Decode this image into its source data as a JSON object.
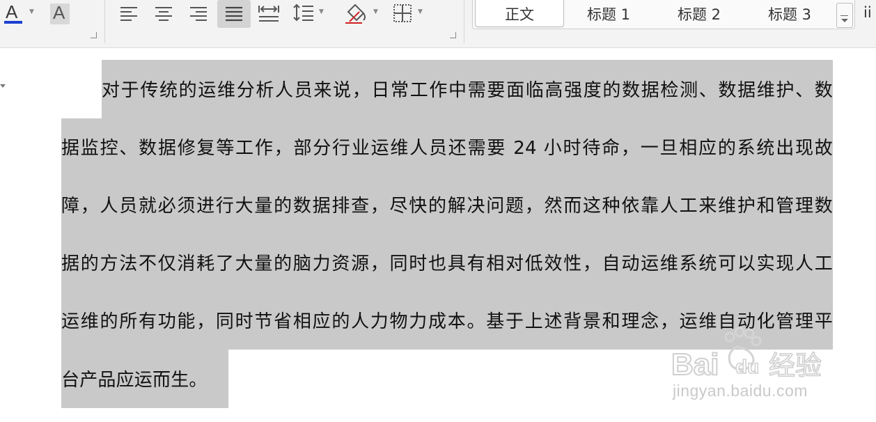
{
  "ribbon": {
    "font_color_letter": "A",
    "char_shading_letter": "A",
    "font_color_underline": "#1a3fd0",
    "groups": {
      "font": [
        "font-color-icon",
        "char-shading-icon"
      ],
      "paragraph": [
        "align-left-icon",
        "align-center-icon",
        "align-right-icon",
        "justify-icon",
        "distributed-icon",
        "line-spacing-icon",
        "shading-icon",
        "borders-icon"
      ]
    },
    "styles": {
      "items": [
        "正文",
        "标题 1",
        "标题 2",
        "标题 3"
      ],
      "selected": "正文",
      "cut_off_next": "ii"
    }
  },
  "document": {
    "paragraph_lines": [
      "对于传统的运维分析人员来说，日常工作中需要面临高强度的数据检测、数据维护、数",
      "据监控、数据修复等工作，部分行业运维人员还需要 24 小时待命，一旦相应的系统出现故",
      "障，人员就必须进行大量的数据排查，尽快的解决问题，然而这种依靠人工来维护和管理数",
      "据的方法不仅消耗了大量的脑力资源，同时也具有相对低效性，自动运维系统可以实现人工",
      "运维的所有功能，同时节省相应的人力物力成本。基于上述背景和理念，运维自动化管理平",
      "台产品应运而生。"
    ],
    "selection_color": "#c9c9c9"
  },
  "watermark": {
    "logo": "Bai du 经验",
    "url": "jingyan.baidu.com"
  }
}
